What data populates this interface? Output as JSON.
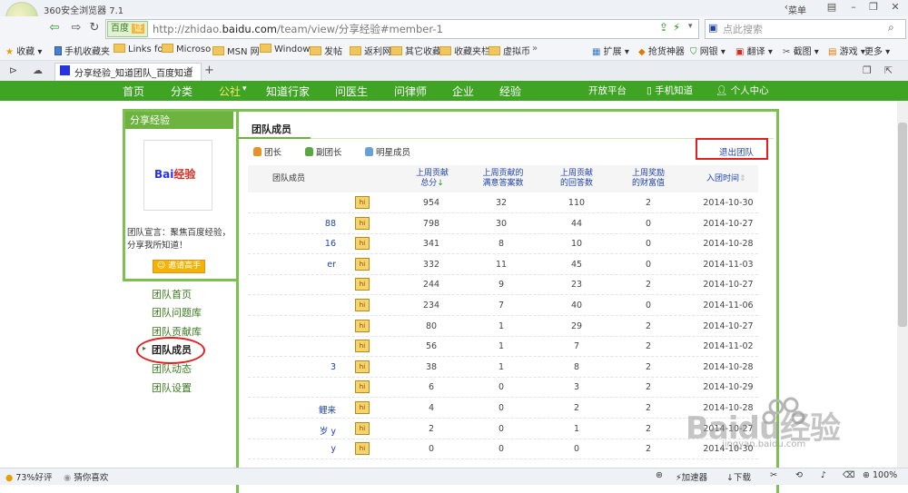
{
  "browser": {
    "app_title": "360安全浏览器 7.1",
    "window": {
      "menu": "菜单"
    },
    "cert_label": "百度",
    "cert_badge": "证",
    "url_prefix": "http://zhidao.",
    "url_domain": "baidu.com",
    "url_suffix": "/team/view/分享经验#member-1",
    "search_placeholder": "点此搜索",
    "favorites": [
      "收藏",
      "手机收藏夹",
      "Links fo",
      "Microso",
      "MSN 网",
      "Window",
      "发帖",
      "返利网",
      "其它收藏",
      "收藏夹栏",
      "虚拟币"
    ],
    "tools": [
      "扩展",
      "抢货神器",
      "网银",
      "翻译",
      "截图",
      "游戏",
      "更多"
    ],
    "tab_title": "分享经验_知道团队_百度知道",
    "status": {
      "zoom": "100%",
      "left1": "73%好评",
      "left2": "猜你喜欢",
      "accel": "加速器",
      "download": "下载"
    }
  },
  "nav": {
    "items": [
      "首页",
      "分类",
      "公社",
      "知道行家",
      "问医生",
      "问律师",
      "企业",
      "经验"
    ],
    "active": "公社",
    "right": [
      "开放平台",
      "手机知道",
      "个人中心"
    ]
  },
  "sidebar": {
    "header": "分享经验",
    "logo_bai": "Bai",
    "logo_rest": "经验",
    "slogan": "团队宣言：聚焦百度经验，分享我所知道！",
    "invite_button": "邀请高手",
    "menu": [
      "团队首页",
      "团队问题库",
      "团队贡献库",
      "团队成员",
      "团队动态",
      "团队设置"
    ],
    "active_menu": "团队成员"
  },
  "main": {
    "title": "团队成员",
    "roles": [
      "团长",
      "副团长",
      "明星成员"
    ],
    "quit_button": "退出团队",
    "columns": [
      "团队成员",
      "上周贡献总分",
      "上周贡献的满意答案数",
      "上周贡献的回答数",
      "上周奖励的财富值",
      "入团时间"
    ],
    "hi_label": "hi",
    "rows": [
      {
        "name": "",
        "score": "954",
        "satisfied": "32",
        "answers": "110",
        "wealth": "2",
        "date": "2014-10-30"
      },
      {
        "name": "88",
        "score": "798",
        "satisfied": "30",
        "answers": "44",
        "wealth": "0",
        "date": "2014-10-27"
      },
      {
        "name": "16",
        "score": "341",
        "satisfied": "8",
        "answers": "10",
        "wealth": "0",
        "date": "2014-10-28"
      },
      {
        "name": "er",
        "score": "332",
        "satisfied": "11",
        "answers": "45",
        "wealth": "0",
        "date": "2014-11-03"
      },
      {
        "name": "",
        "score": "244",
        "satisfied": "9",
        "answers": "23",
        "wealth": "2",
        "date": "2014-10-27"
      },
      {
        "name": "",
        "score": "234",
        "satisfied": "7",
        "answers": "40",
        "wealth": "0",
        "date": "2014-11-06"
      },
      {
        "name": "",
        "score": "80",
        "satisfied": "1",
        "answers": "29",
        "wealth": "2",
        "date": "2014-10-27"
      },
      {
        "name": "",
        "score": "56",
        "satisfied": "1",
        "answers": "7",
        "wealth": "2",
        "date": "2014-11-02"
      },
      {
        "name": "3",
        "score": "38",
        "satisfied": "1",
        "answers": "8",
        "wealth": "2",
        "date": "2014-10-28"
      },
      {
        "name": "",
        "score": "6",
        "satisfied": "0",
        "answers": "3",
        "wealth": "2",
        "date": "2014-10-29"
      },
      {
        "name": "鲤来",
        "score": "4",
        "satisfied": "0",
        "answers": "2",
        "wealth": "2",
        "date": "2014-10-28"
      },
      {
        "name": "岁 y",
        "score": "2",
        "satisfied": "0",
        "answers": "1",
        "wealth": "2",
        "date": "2014-10-27"
      },
      {
        "name": "y",
        "score": "0",
        "satisfied": "0",
        "answers": "0",
        "wealth": "2",
        "date": "2014-10-30"
      }
    ]
  },
  "watermark": {
    "brand": "Baidu经验",
    "url": "jingyan.baidu.com"
  },
  "colors": {
    "green": "#3fa324",
    "accent_red": "#e02020",
    "link_blue": "#2244aa"
  }
}
